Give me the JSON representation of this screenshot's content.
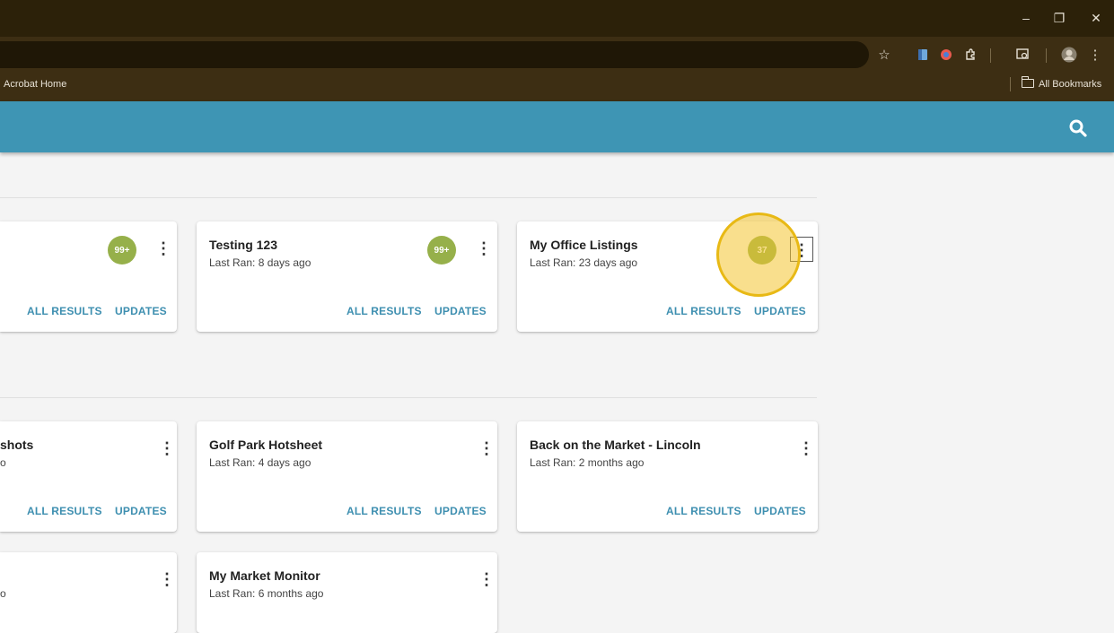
{
  "browser": {
    "window_controls": [
      "–",
      "❐",
      "✕"
    ],
    "bookmarks": {
      "acrobat": "Acrobat Home",
      "all_bookmarks": "All Bookmarks"
    }
  },
  "colors": {
    "header": "#3e95b4",
    "badge": "#96b04a",
    "link": "#3e8fb0",
    "highlight": "#f4c430"
  },
  "cards": [
    {
      "title": "",
      "subtitle": "",
      "badge": "99+",
      "all_results": "ALL RESULTS",
      "updates": "UPDATES"
    },
    {
      "title": "Testing 123",
      "subtitle": "Last Ran: 8 days ago",
      "badge": "99+",
      "all_results": "ALL RESULTS",
      "updates": "UPDATES"
    },
    {
      "title": "My Office Listings",
      "subtitle": "Last Ran: 23 days ago",
      "badge": "37",
      "all_results": "ALL RESULTS",
      "updates": "UPDATES"
    },
    {
      "title": "shots",
      "subtitle": "o",
      "all_results": "ALL RESULTS",
      "updates": "UPDATES"
    },
    {
      "title": "Golf Park Hotsheet",
      "subtitle": "Last Ran: 4 days ago",
      "all_results": "ALL RESULTS",
      "updates": "UPDATES"
    },
    {
      "title": "Back on the Market - Lincoln",
      "subtitle": "Last Ran: 2 months ago",
      "all_results": "ALL RESULTS",
      "updates": "UPDATES"
    },
    {
      "title": "",
      "subtitle": "o"
    },
    {
      "title": "My Market Monitor",
      "subtitle": "Last Ran: 6 months ago"
    }
  ]
}
